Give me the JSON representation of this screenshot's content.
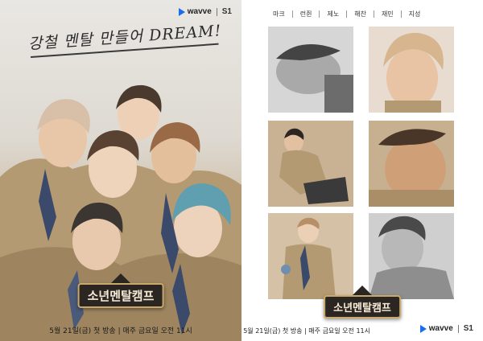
{
  "left_poster": {
    "brand": {
      "wavve": "wavve",
      "sbs": "S1"
    },
    "tagline": "강철 멘탈 만들어 DREAM!",
    "show_title": "소년멘탈캠프",
    "airdate": "5월 21일(금) 첫 방송 | 매주 금요일 오전 11시"
  },
  "right_poster": {
    "members": [
      "마크",
      "런쥔",
      "제노",
      "해찬",
      "재민",
      "지성"
    ],
    "show_title": "소년멘탈캠프",
    "airdate": "5월 21일(금) 첫 방송 | 매주 금요일 오전 11시",
    "brand": {
      "wavve": "wavve",
      "sbs": "S1"
    }
  },
  "colors": {
    "wavve_blue": "#1a6df0",
    "uniform_khaki": "#b49a72",
    "scarf_navy": "#3b4a6b",
    "background": "#ffffff"
  }
}
